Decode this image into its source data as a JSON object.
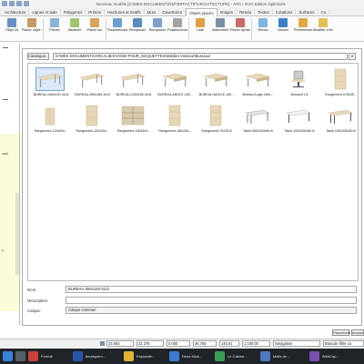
{
  "window": {
    "title": "Nouveau modèle [D:\\MES DOCUMENTS\\INTERFACTIF\\ARCHITECTURE] - ARC+ EVO Edition Optimisée"
  },
  "ribbon_tabs": [
    "Architecture",
    "Lignes et aide",
    "Polygones",
    "Primes",
    "Hachures et motifs",
    "Murs",
    "Ouvertures",
    "Objets placés",
    "Images",
    "Rendu",
    "Textes",
    "Cotations",
    "Surfaces",
    "Co"
  ],
  "ribbon_buttons": [
    {
      "label": "Objet 2d",
      "color": "#6a8fc4"
    },
    {
      "label": "Placer objet 3d",
      "color": "#c49a6a"
    },
    {
      "label": "Pièces",
      "color": "#8fb1d9"
    },
    {
      "label": "Aléatoire",
      "color": "#a4c36f"
    },
    {
      "label": "Placer sur",
      "color": "#d9a45f"
    },
    {
      "label": "Paramétriques",
      "color": "#6f9fcc"
    },
    {
      "label": "Remplacer",
      "color": "#5c8abb"
    },
    {
      "label": "Remplacer",
      "color": "#7f9fc9"
    },
    {
      "label": "Positionnements",
      "color": "#a3a3a3"
    },
    {
      "label": "Liste",
      "color": "#dea04a"
    },
    {
      "label": "Assembler",
      "color": "#7d8fa3"
    },
    {
      "label": "Placer symboles",
      "color": "#c76c6c"
    },
    {
      "label": "Rendu",
      "color": "#7fb4dd"
    },
    {
      "label": "Sauver",
      "color": "#3f7fc2"
    },
    {
      "label": "Préférences",
      "color": "#e0a84b"
    },
    {
      "label": "Modifier chemin",
      "color": "#e2c15a"
    }
  ],
  "left_panel": {
    "labels": [
      "cuel",
      "y"
    ]
  },
  "library": {
    "catalog_button": "Catalogue...",
    "path": "D:\\MES DOCUMENTS\\ARCALIB-EVO\\3D-POUR_MAQUETTES\\Mobilier interieur\\Bureaux\\",
    "items": [
      {
        "label": "BUREAU-080x150-3d.iii",
        "kind": "desk",
        "selected": true
      },
      {
        "label": "BUREAU-080x180-3d.iii",
        "kind": "desk",
        "selected": false
      },
      {
        "label": "BUREAU-100x180-3d.iii",
        "kind": "desk",
        "selected": false
      },
      {
        "label": "BUREAU-ANGLE-180...",
        "kind": "desk-angle",
        "selected": false
      },
      {
        "label": "BUREAU-ANGLE-180...",
        "kind": "desk-angle",
        "selected": false
      },
      {
        "label": "Bureau-Angle-180x...",
        "kind": "desk-angle",
        "selected": false
      },
      {
        "label": "Bureau01.iii",
        "kind": "chair",
        "selected": false
      },
      {
        "label": "Rangement-076x35...",
        "kind": "cabinet-tall",
        "selected": false
      },
      {
        "label": "Rangement-120x30x...",
        "kind": "cabinet-low",
        "selected": false
      },
      {
        "label": "Rangement-120x30x...",
        "kind": "cabinet-tall",
        "selected": false
      },
      {
        "label": "Rangement-150x30x...",
        "kind": "shelf",
        "selected": false
      },
      {
        "label": "Rangement-180x30x...",
        "kind": "cabinet-tall",
        "selected": false
      },
      {
        "label": "Rangement-70x35.iii",
        "kind": "cabinet-tall",
        "selected": false
      },
      {
        "label": "Table-080x200x80.iii",
        "kind": "table-metal",
        "selected": false
      },
      {
        "label": "Table-100x200x80.iii",
        "kind": "table-white",
        "selected": false
      },
      {
        "label": "Table-100x200x80.iii",
        "kind": "table-wood",
        "selected": false
      }
    ]
  },
  "fields": {
    "nom_label": "Nom:",
    "nom_value": "BUREAU-080x150-3d.iii",
    "description_label": "Description:",
    "description_value": "",
    "calque_label": "Calque:",
    "calque_value": "Calque commun"
  },
  "buttons": {
    "placer": "Placement",
    "annuler": "Annuler"
  },
  "statusbar": {
    "x": "23.083",
    "y": "22.378",
    "z": "0.000",
    "l": "36.755",
    "angle": "145.91",
    "scale": "1:100.00",
    "mode": "Navigation",
    "filter": "Bascule filtre ca"
  },
  "taskbar": [
    {
      "label": "Format",
      "color": "#c9433a"
    },
    {
      "label": "boutiquem...",
      "color": "#2b56a8"
    },
    {
      "label": "Explorate...",
      "color": "#e2b33b"
    },
    {
      "label": "Deux Mois...",
      "color": "#3c7bd0"
    },
    {
      "label": "Le Cabine...",
      "color": "#3a9e57"
    },
    {
      "label": "Mails de ...",
      "color": "#4e78c0"
    },
    {
      "label": "WebCap...",
      "color": "#7a4fb0"
    }
  ]
}
